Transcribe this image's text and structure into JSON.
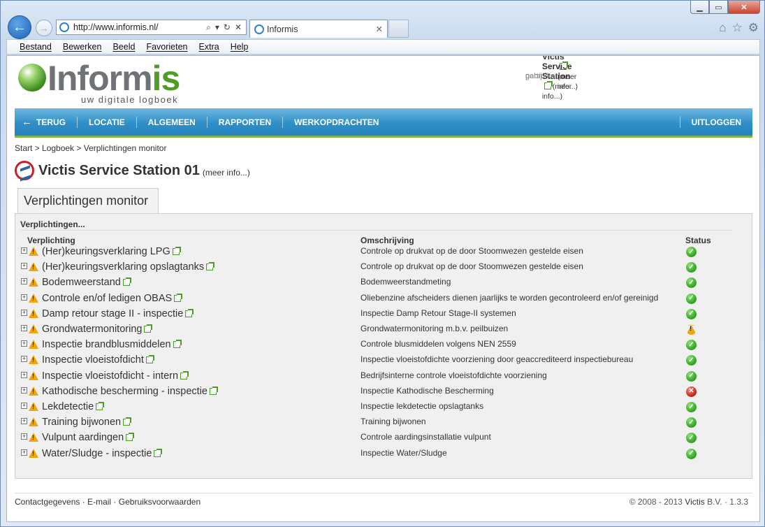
{
  "browser": {
    "url_prefix": "http://www.",
    "url_domain": "informis",
    "url_suffix": ".nl/",
    "tab_title": "Informis",
    "menu": [
      "Bestand",
      "Bewerken",
      "Beeld",
      "Favorieten",
      "Extra",
      "Help"
    ]
  },
  "brand": {
    "logo_in": "Inform",
    "logo_is": "is",
    "tagline": "uw digitale logboek"
  },
  "meta": {
    "partij_label": "partij",
    "partij_value": "Victis Service Station",
    "partij_more": "(meer info...)",
    "gebruiker_label": "gebruiker",
    "gebruiker_more": "(meer info...)"
  },
  "nav": {
    "back": "TERUG",
    "items": [
      "LOCATIE",
      "ALGEMEEN",
      "RAPPORTEN",
      "WERKOPDRACHTEN"
    ],
    "logout": "UITLOGGEN"
  },
  "breadcrumb": "Start > Logboek > Verplichtingen monitor",
  "station": {
    "name": "Victis Service Station 01",
    "more": "(meer info...)"
  },
  "tab_label": "Verplichtingen monitor",
  "panel": {
    "header": "Verplichtingen...",
    "col_obligation": "Verplichting",
    "col_description": "Omschrijving",
    "col_status": "Status",
    "rows": [
      {
        "name": "(Her)keuringsverklaring LPG",
        "description": "Controle op drukvat op de door Stoomwezen gestelde eisen",
        "status": "ok"
      },
      {
        "name": "(Her)keuringsverklaring opslagtanks",
        "description": "Controle op drukvat op de door Stoomwezen gestelde eisen",
        "status": "ok"
      },
      {
        "name": "Bodemweerstand",
        "description": "Bodemweerstandmeting",
        "status": "ok"
      },
      {
        "name": "Controle en/of ledigen OBAS",
        "description": "Oliebenzine afscheiders dienen jaarlijks te worden gecontroleerd en/of gereinigd",
        "status": "ok"
      },
      {
        "name": "Damp retour stage II - inspectie",
        "description": "Inspectie Damp Retour Stage-II systemen",
        "status": "ok"
      },
      {
        "name": "Grondwatermonitoring",
        "description": "Grondwatermonitoring m.b.v. peilbuizen",
        "status": "warn"
      },
      {
        "name": "Inspectie brandblusmiddelen",
        "description": "Controle blusmiddelen volgens NEN 2559",
        "status": "ok"
      },
      {
        "name": "Inspectie vloeistofdicht",
        "description": "Inspectie vloeistofdichte voorziening door geaccrediteerd inspectiebureau",
        "status": "ok"
      },
      {
        "name": "Inspectie vloeistofdicht - intern",
        "description": "Bedrijfsinterne controle vloeistofdichte voorziening",
        "status": "ok"
      },
      {
        "name": "Kathodische bescherming - inspectie",
        "description": "Inspectie Kathodische Bescherming",
        "status": "err"
      },
      {
        "name": "Lekdetectie",
        "description": "Inspectie lekdetectie opslagtanks",
        "status": "ok"
      },
      {
        "name": "Training bijwonen",
        "description": "Training bijwonen",
        "status": "ok"
      },
      {
        "name": "Vulpunt aardingen",
        "description": "Controle aardingsinstallatie vulpunt",
        "status": "ok"
      },
      {
        "name": "Water/Sludge - inspectie",
        "description": "Inspectie Water/Sludge",
        "status": "ok"
      }
    ]
  },
  "footer": {
    "links": [
      "Contactgegevens",
      "E-mail",
      "Gebruiksvoorwaarden"
    ],
    "separator": " · ",
    "copyright_prefix": "© 2008 - 2013 ",
    "copyright_brand": "Victis",
    "copyright_suffix": " B.V. · 1.3.3"
  }
}
